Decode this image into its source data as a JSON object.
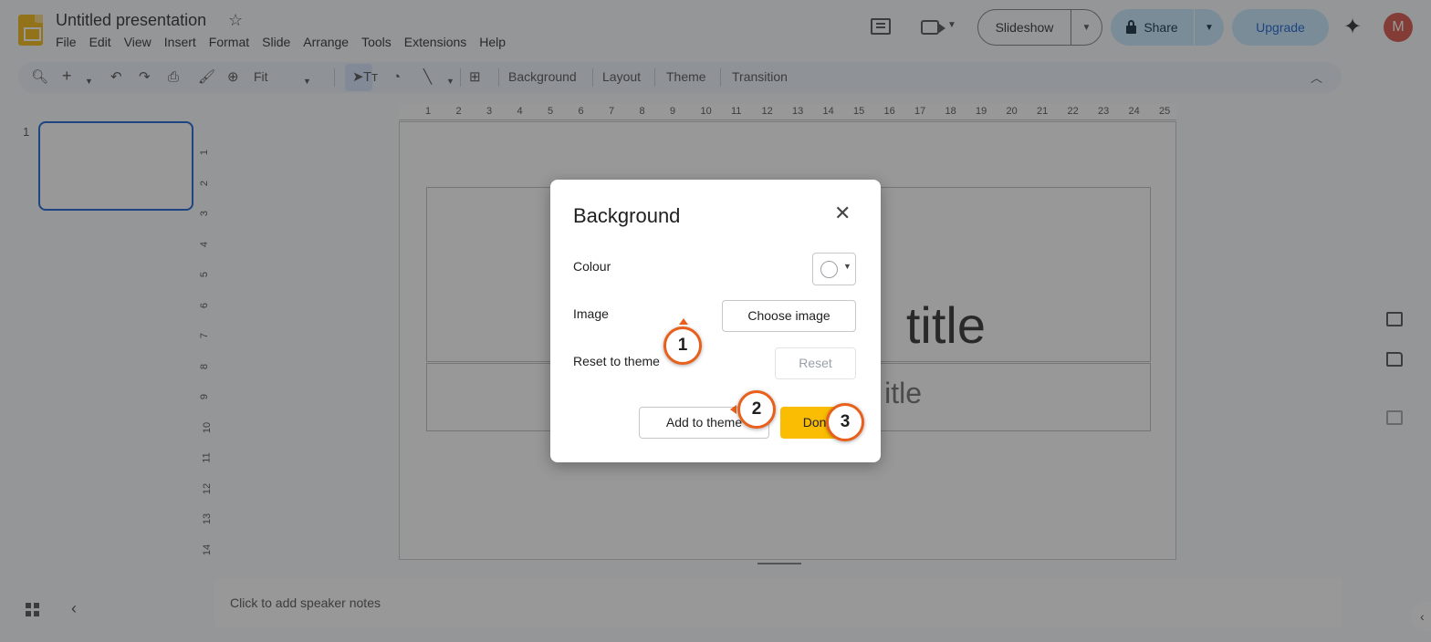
{
  "app": {
    "doc_title": "Untitled presentation",
    "menu": [
      "File",
      "Edit",
      "View",
      "Insert",
      "Format",
      "Slide",
      "Arrange",
      "Tools",
      "Extensions",
      "Help"
    ],
    "slideshow_label": "Slideshow",
    "share_label": "Share",
    "upgrade_label": "Upgrade",
    "avatar_initial": "M"
  },
  "toolbar": {
    "zoom_value": "Fit",
    "background_label": "Background",
    "layout_label": "Layout",
    "theme_label": "Theme",
    "transition_label": "Transition"
  },
  "filmstrip": {
    "slide_number": "1"
  },
  "ruler": {
    "horizontal": [
      "1",
      "2",
      "3",
      "4",
      "5",
      "6",
      "7",
      "8",
      "9",
      "10",
      "11",
      "12",
      "13",
      "14",
      "15",
      "16",
      "17",
      "18",
      "19",
      "20",
      "21",
      "22",
      "23",
      "24",
      "25"
    ],
    "vertical": [
      "1",
      "2",
      "3",
      "4",
      "5",
      "6",
      "7",
      "8",
      "9",
      "10",
      "11",
      "12",
      "13",
      "14"
    ]
  },
  "slide": {
    "title_partial": "title",
    "subtitle_partial": "itle"
  },
  "notes": {
    "placeholder": "Click to add speaker notes"
  },
  "dialog": {
    "title": "Background",
    "colour_label": "Colour",
    "image_label": "Image",
    "reset_label": "Reset to theme",
    "choose_image_button": "Choose image",
    "reset_button": "Reset",
    "add_to_theme_button": "Add to theme",
    "done_button": "Done"
  },
  "markers": [
    "1",
    "2",
    "3"
  ],
  "colors": {
    "accent": "#0b57d0",
    "share_bg": "#c2e7ff",
    "done_bg": "#fbbc04",
    "marker_ring": "#e8601c",
    "avatar_bg": "#d4493a"
  }
}
